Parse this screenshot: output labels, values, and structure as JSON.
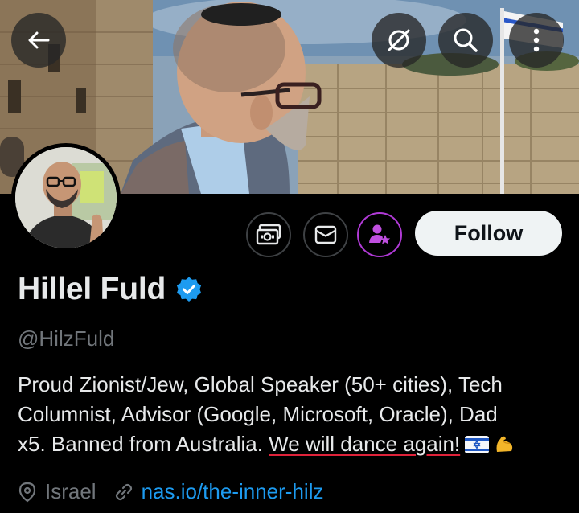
{
  "header": {
    "back_icon": "arrow-left-icon",
    "hide_icon": "eye-slash-icon",
    "search_icon": "search-icon",
    "more_icon": "more-vertical-icon"
  },
  "profile": {
    "display_name": "Hillel Fuld",
    "verified": true,
    "verified_color": "#1d9bf0",
    "handle": "@HilzFuld",
    "bio": {
      "line1": "Proud Zionist/Jew, Global Speaker (50+ cities), Tech",
      "line2": "Columnist, Advisor (Google, Microsoft, Oracle), Dad",
      "line3_prefix": "x5. Banned from Australia. ",
      "line3_highlight": "We will dance again!",
      "emojis": [
        "israel-flag-emoji",
        "flexed-biceps-emoji"
      ]
    },
    "location": "Israel",
    "website": "nas.io/the-inner-hilz"
  },
  "actions": {
    "subscribe_icon": "subscribe-money-icon",
    "message_icon": "envelope-icon",
    "creator_icon": "creator-subscribe-icon",
    "follow_label": "Follow"
  },
  "colors": {
    "background": "#000000",
    "text_primary": "#e7e9ea",
    "text_secondary": "#71767b",
    "link": "#1d9bf0",
    "accent_purple": "#b03ad6",
    "highlight_underline": "#e0223a"
  }
}
